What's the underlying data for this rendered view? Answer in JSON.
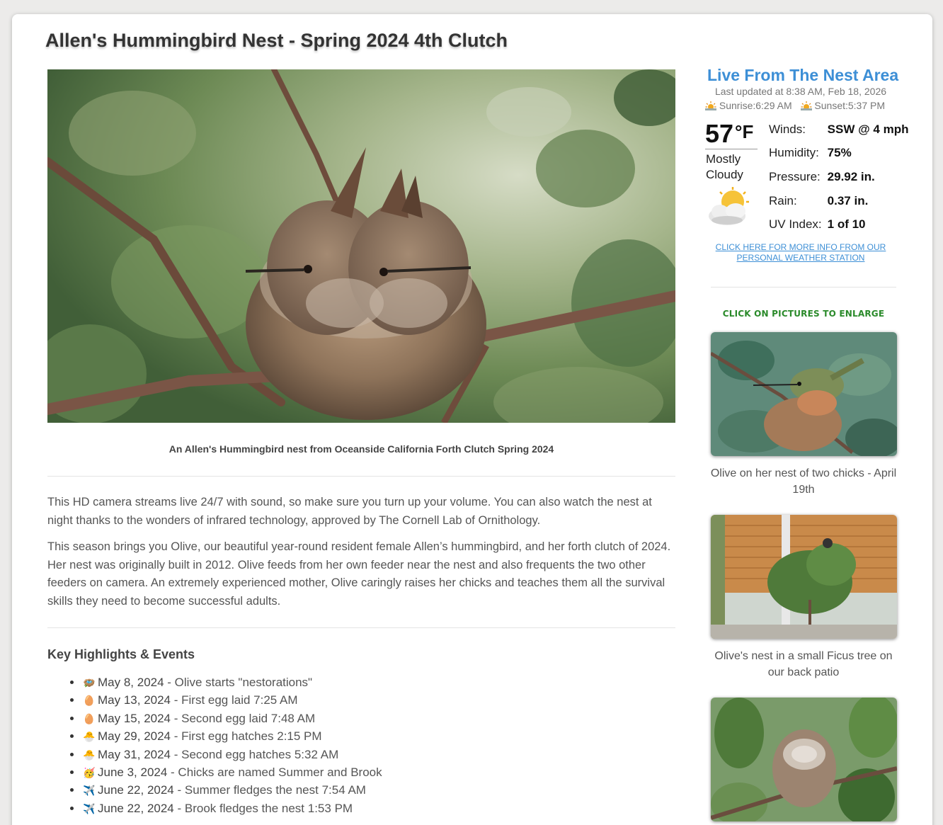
{
  "page": {
    "title": "Allen's Hummingbird Nest - Spring 2024 4th Clutch"
  },
  "hero": {
    "caption": "An Allen's Hummingbird nest from Oceanside California Forth Clutch Spring 2024"
  },
  "intro": {
    "paragraph1": "This HD camera streams live 24/7 with sound, so make sure you turn up your volume. You can also watch the nest at night thanks to the wonders of infrared technology, approved by The Cornell Lab of Ornithology.",
    "paragraph2": "This season brings you Olive, our beautiful year-round resident female Allen’s hummingbird, and her forth clutch of 2024. Her nest was originally built in 2012. Olive feeds from her own feeder near the nest and also frequents the two other feeders on camera. An extremely experienced mother, Olive caringly raises her chicks and teaches them all the survival skills they need to become successful adults."
  },
  "highlights": {
    "title": "Key Highlights & Events",
    "items": [
      {
        "emoji": "🪺",
        "date": "May 8, 2024",
        "text": " - Olive starts \"nestorations\""
      },
      {
        "emoji": "🥚",
        "date": "May 13, 2024",
        "text": " - First egg laid 7:25 AM"
      },
      {
        "emoji": "🥚",
        "date": "May 15, 2024",
        "text": " - Second egg laid 7:48 AM"
      },
      {
        "emoji": "🐣",
        "date": "May 29, 2024",
        "text": " - First egg hatches 2:15 PM"
      },
      {
        "emoji": "🐣",
        "date": "May 31, 2024",
        "text": " - Second egg hatches 5:32 AM"
      },
      {
        "emoji": "🥳",
        "date": "June 3, 2024",
        "text": " - Chicks are named Summer and Brook"
      },
      {
        "emoji": "✈️",
        "date": "June 22, 2024",
        "text": " - Summer fledges the nest 7:54 AM"
      },
      {
        "emoji": "✈️",
        "date": "June 22, 2024",
        "text": " - Brook fledges the nest 1:53 PM"
      }
    ]
  },
  "weather": {
    "title": "Live From The Nest Area",
    "last_updated": "Last updated at 8:38 AM, Feb 18, 2026",
    "sunrise": "Sunrise:6:29 AM",
    "sunset": "Sunset:5:37 PM",
    "temp": "57",
    "temp_unit": "°F",
    "condition": "Mostly Cloudy",
    "rows": [
      {
        "label": "Winds:",
        "value": "SSW @ 4 mph"
      },
      {
        "label": "Humidity:",
        "value": "75%"
      },
      {
        "label": "Pressure:",
        "value": "29.92 in."
      },
      {
        "label": "Rain:",
        "value": "0.37 in."
      },
      {
        "label": "UV Index:",
        "value": "1 of 10"
      }
    ],
    "station_link": "CLICK HERE FOR MORE INFO FROM OUR PERSONAL WEATHER STATION"
  },
  "gallery": {
    "heading": "CLICK ON PICTURES TO ENLARGE",
    "items": [
      {
        "caption": "Olive on her nest of two chicks - April 19th"
      },
      {
        "caption": "Olive's nest in a small Ficus tree on our back patio"
      },
      {
        "caption": ""
      }
    ]
  }
}
